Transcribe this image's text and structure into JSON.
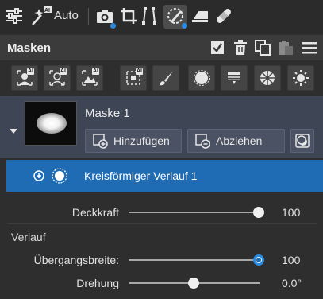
{
  "toolbar": {
    "auto_label": "Auto",
    "icons": [
      "adjustments-icon",
      "magic-wand-ai-icon",
      "camera-icon",
      "crop-icon",
      "straighten-icon",
      "mask-brush-icon",
      "bandage-icon"
    ],
    "selected": "mask-brush-icon"
  },
  "header": {
    "title": "Masken",
    "icons": [
      "check-icon",
      "trash-icon",
      "duplicate-icon",
      "paste-icon",
      "menu-icon"
    ]
  },
  "mask_tools": [
    "subject-ai-icon",
    "person-ai-icon",
    "landscape-ai-icon",
    "select-ai-icon",
    "brush-icon",
    "radial-icon",
    "linear-gradient-icon",
    "color-range-icon",
    "luminance-range-icon"
  ],
  "mask": {
    "name": "Maske 1",
    "add_label": "Hinzufügen",
    "subtract_label": "Abziehen"
  },
  "component": {
    "label": "Kreisförmiger Verlauf 1"
  },
  "sliders": {
    "opacity": {
      "label": "Deckkraft",
      "value_text": "100",
      "fraction": 1.0
    },
    "section_label": "Verlauf",
    "feather": {
      "label": "Übergangsbreite:",
      "value_text": "100",
      "fraction": 1.0
    },
    "rotation": {
      "label": "Drehung",
      "value_text": "0.0°",
      "fraction": 0.5
    }
  },
  "colors": {
    "accent": "#1f6cb4",
    "panel": "#3e4655",
    "background": "#2e2e2e"
  }
}
